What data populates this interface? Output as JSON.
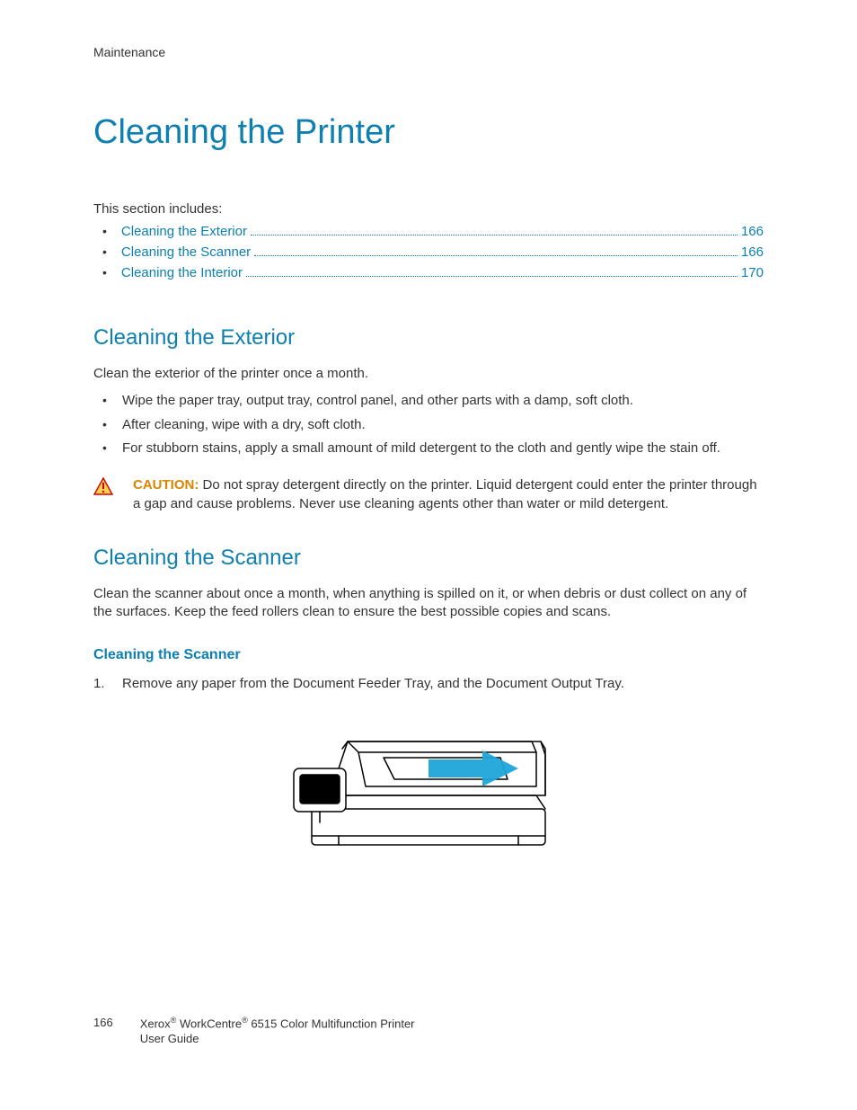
{
  "header": {
    "section": "Maintenance"
  },
  "title": "Cleaning the Printer",
  "intro": "This section includes:",
  "toc": [
    {
      "label": "Cleaning the Exterior",
      "page": "166"
    },
    {
      "label": "Cleaning the Scanner",
      "page": "166"
    },
    {
      "label": "Cleaning the Interior",
      "page": "170"
    }
  ],
  "exterior": {
    "heading": "Cleaning the Exterior",
    "lead": "Clean the exterior of the printer once a month.",
    "bullets": [
      "Wipe the paper tray, output tray, control panel, and other parts with a damp, soft cloth.",
      "After cleaning, wipe with a dry, soft cloth.",
      "For stubborn stains, apply a small amount of mild detergent to the cloth and gently wipe the stain off."
    ],
    "caution_label": "CAUTION:",
    "caution_text": " Do not spray detergent directly on the printer. Liquid detergent could enter the printer through a gap and cause problems. Never use cleaning agents other than water or mild detergent."
  },
  "scanner": {
    "heading": "Cleaning the Scanner",
    "lead": "Clean the scanner about once a month, when anything is spilled on it, or when debris or dust collect on any of the surfaces. Keep the feed rollers clean to ensure the best possible copies and scans.",
    "subheading": "Cleaning the Scanner",
    "step_num": "1.",
    "step_text": "Remove any paper from the Document Feeder Tray, and the Document Output Tray."
  },
  "footer": {
    "page": "166",
    "line1": "Xerox® WorkCentre® 6515 Color Multifunction Printer",
    "line2": "User Guide"
  }
}
